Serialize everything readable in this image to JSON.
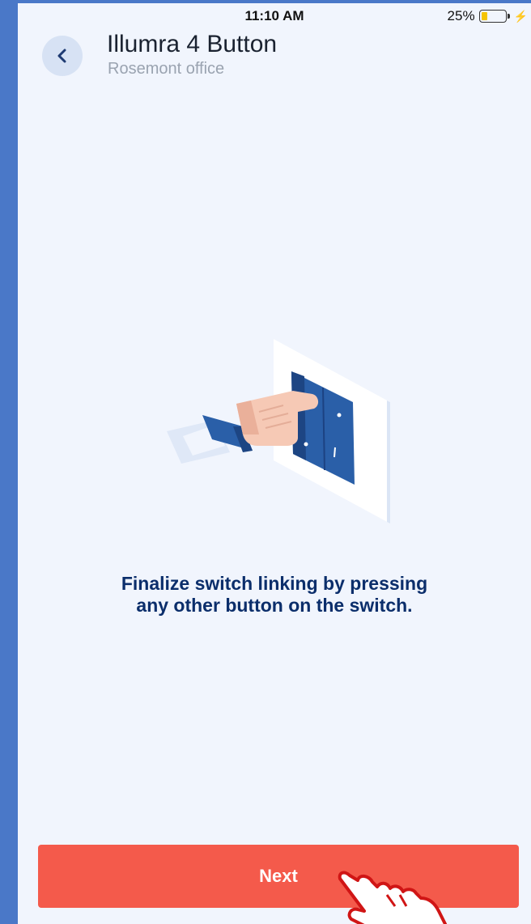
{
  "status_bar": {
    "time": "11:10 AM",
    "battery_percent": "25%",
    "battery_level": 0.25,
    "battery_color": "#f5c400",
    "charging_icon": "bolt-icon"
  },
  "header": {
    "back_icon": "chevron-left-icon",
    "title": "Illumra 4 Button",
    "subtitle": "Rosemont office"
  },
  "illustration": {
    "icon": "hand-pressing-switch-illustration"
  },
  "instruction": {
    "line1": "Finalize switch linking by pressing",
    "line2": "any other button on the switch."
  },
  "footer": {
    "next_label": "Next",
    "next_color": "#f45a4b",
    "cursor_icon": "hand-pointer-cursor-icon"
  },
  "colors": {
    "frame": "#4a78c8",
    "background": "#f1f5fd",
    "accent_navy": "#0b2e6b",
    "switch_blue": "#2a5fa8"
  }
}
